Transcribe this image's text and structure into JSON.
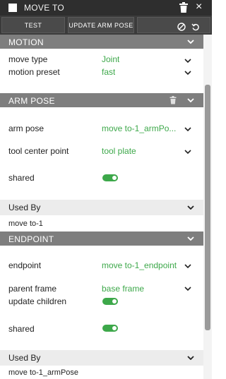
{
  "window": {
    "title": "MOVE TO"
  },
  "toolbar": {
    "test_label": "TEST",
    "update_label": "UPDATE ARM POSE"
  },
  "motion": {
    "header": "MOTION",
    "move_type_label": "move type",
    "move_type_value": "Joint",
    "preset_label": "motion preset",
    "preset_value": "fast"
  },
  "arm_pose": {
    "header": "ARM POSE",
    "pose_label": "arm pose",
    "pose_value": "move to-1_armPo...",
    "tcp_label": "tool center point",
    "tcp_value": "tool plate",
    "shared_label": "shared",
    "shared_on": true,
    "used_by_label": "Used By",
    "used_by_item": "move to-1"
  },
  "endpoint": {
    "header": "ENDPOINT",
    "endpoint_label": "endpoint",
    "endpoint_value": "move to-1_endpoint",
    "parent_label": "parent frame",
    "parent_value": "base frame",
    "update_children_label": "update children",
    "update_children_on": true,
    "shared_label": "shared",
    "shared_on": true,
    "used_by_label": "Used By",
    "used_by_item": "move to-1_armPose"
  },
  "colors": {
    "accent_green": "#3da84a",
    "section_header": "#7e7e7e",
    "titlebar": "#2e2e2e"
  }
}
